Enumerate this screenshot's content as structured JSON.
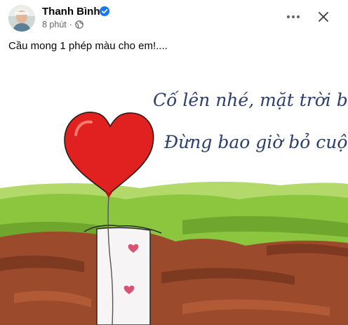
{
  "author": {
    "name": "Thanh Bình"
  },
  "post": {
    "time": "8 phút",
    "caption": "Cầu mong 1 phép màu cho em!....",
    "image_text": {
      "line1": "Cố lên nhé, mặt trời bé con,",
      "line2": "Đừng bao giờ bỏ cuộc..."
    }
  },
  "icons": {
    "verified": "verified-badge-icon",
    "audience": "globe-icon",
    "more": "more-options-icon",
    "close": "close-icon"
  },
  "colors": {
    "verified": "#1877f2",
    "meta_text": "#65676b",
    "heart": "#e0211f",
    "grass": "#8cc63e",
    "soil": "#9b4a2c"
  }
}
